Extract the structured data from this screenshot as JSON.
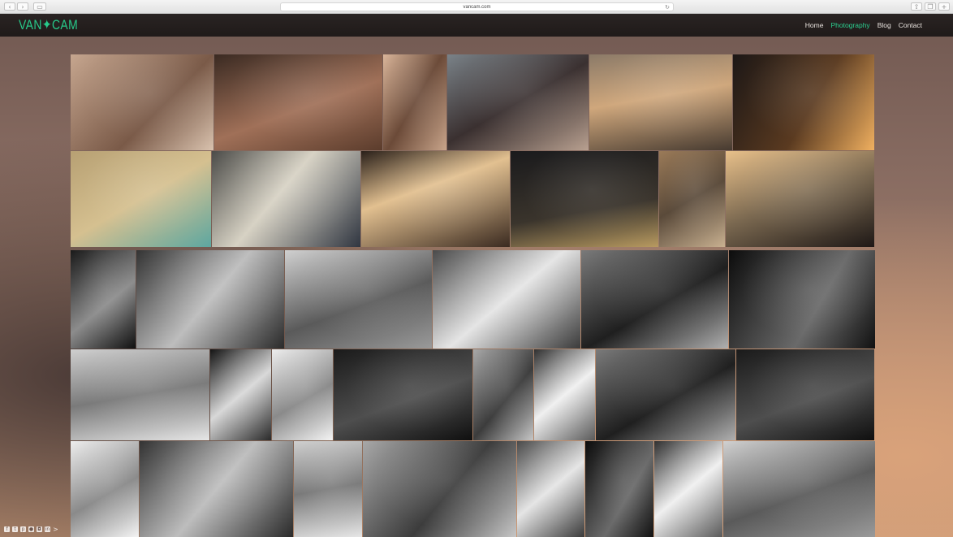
{
  "browser": {
    "url": "vancam.com",
    "back_icon": "‹",
    "forward_icon": "›",
    "sidebar_icon": "▭",
    "reload_icon": "↻",
    "share_icon": "⇧",
    "tabs_icon": "❐",
    "newtab_icon": "+"
  },
  "site": {
    "logo": "VAN✦CAM",
    "nav": {
      "home": "Home",
      "photography": "Photography",
      "blog": "Blog",
      "contact": "Contact"
    }
  },
  "social": {
    "facebook": "f",
    "twitter": "t",
    "pinterest": "p",
    "flickr": "●",
    "instagram": "◘",
    "linkedin": "in",
    "more": ">"
  }
}
